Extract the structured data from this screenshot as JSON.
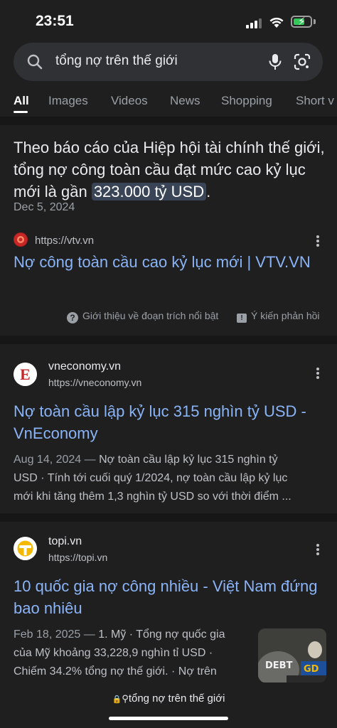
{
  "status": {
    "time": "23:51"
  },
  "search": {
    "query": "tổng nợ trên thế giới"
  },
  "tabs": [
    "All",
    "Images",
    "Videos",
    "News",
    "Shopping",
    "Short v"
  ],
  "featured": {
    "text_before": "Theo báo cáo của Hiệp hội tài chính thế giới, tổng nợ công toàn cầu đạt mức cao kỷ lục mới là gần ",
    "highlight": "323.000 tỷ USD",
    "text_after": ".",
    "date": "Dec 5, 2024",
    "url": "https://vtv.vn",
    "title": "Nợ công toàn cầu cao kỷ lục mới | VTV.VN",
    "about_label": "Giới thiệu về đoạn trích nổi bật",
    "feedback_label": "Ý kiến phản hồi"
  },
  "results": [
    {
      "site": "vneconomy.vn",
      "url": "https://vneconomy.vn",
      "favicon_letter": "E",
      "title": "Nợ toàn cầu lập kỷ lục 315 nghìn tỷ USD - VnEconomy",
      "date": "Aug 14, 2024",
      "snippet_line1": "Nợ toàn cầu lập kỷ lục 315 nghìn tỷ",
      "snippet_line2": "USD · Tính tới cuối quý 1/2024, nợ toàn cầu lập kỷ lục",
      "snippet_line3": "mới khi tăng thêm 1,3 nghìn tỷ USD so với thời điểm ..."
    },
    {
      "site": "topi.vn",
      "url": "https://topi.vn",
      "title": "10 quốc gia nợ công nhiều - Việt Nam đứng bao nhiêu",
      "date": "Feb 18, 2025",
      "snippet_line1": "1. Mỹ · Tổng nợ quốc gia",
      "snippet_line2": "của Mỹ khoảng 33,228,9 nghìn tỉ USD ·",
      "snippet_line3": "Chiếm 34.2% tổng nợ thế giới. · Nợ trên",
      "thumb_text_1": "DEBT",
      "thumb_text_2": "GD"
    }
  ],
  "bottom": {
    "url_text": "tổng nợ trên thế giới"
  },
  "colors": {
    "link": "#8ab4f8",
    "background": "#1f1f1f",
    "highlight": "#394457"
  }
}
